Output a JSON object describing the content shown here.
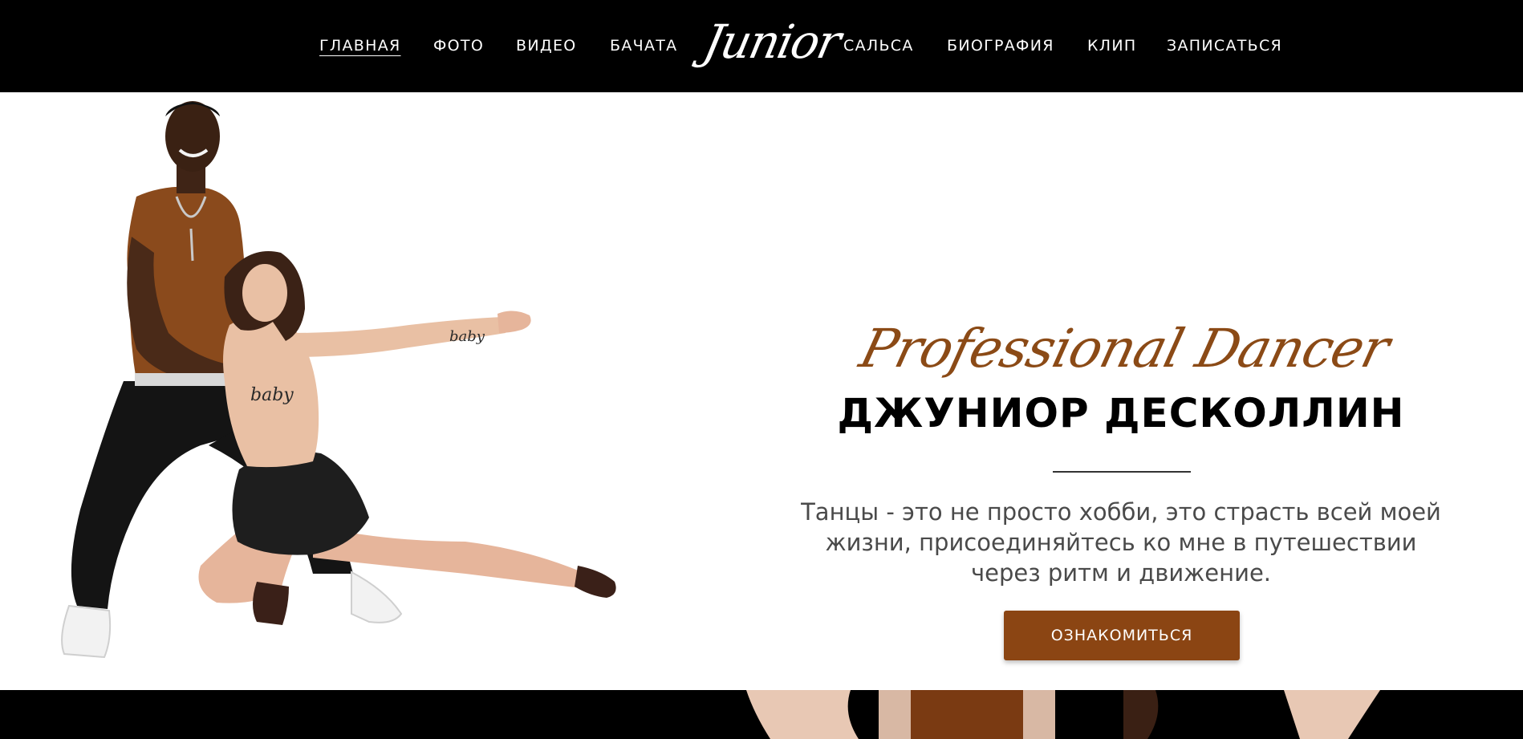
{
  "nav": {
    "items": [
      {
        "label": "ГЛАВНАЯ",
        "active": true
      },
      {
        "label": "ФОТО",
        "active": false
      },
      {
        "label": "ВИДЕО",
        "active": false
      },
      {
        "label": "БАЧАТА",
        "active": false
      },
      {
        "label": "САЛЬСА",
        "active": false
      },
      {
        "label": "БИОГРАФИЯ",
        "active": false
      },
      {
        "label": "КЛИП",
        "active": false
      },
      {
        "label": "ЗАПИСАТЬСЯ",
        "active": false
      }
    ],
    "logo_text": "Junior"
  },
  "hero": {
    "script_title": "Professional Dancer",
    "title": "ДЖУНИОР ДЕСКОЛЛИН",
    "tagline_lines": [
      "Танцы - это не просто хобби, это страсть всей моей",
      "жизни, присоединяйтесь ко мне в путешествии",
      "через ритм и движение."
    ],
    "cta_label": "ОЗНАКОМИТЬСЯ",
    "shirt_print_text": "baby"
  },
  "colors": {
    "header_bg": "#000000",
    "accent": "#8b4513",
    "script_title": "#8b4a16",
    "body_text": "#4a4a4a"
  }
}
